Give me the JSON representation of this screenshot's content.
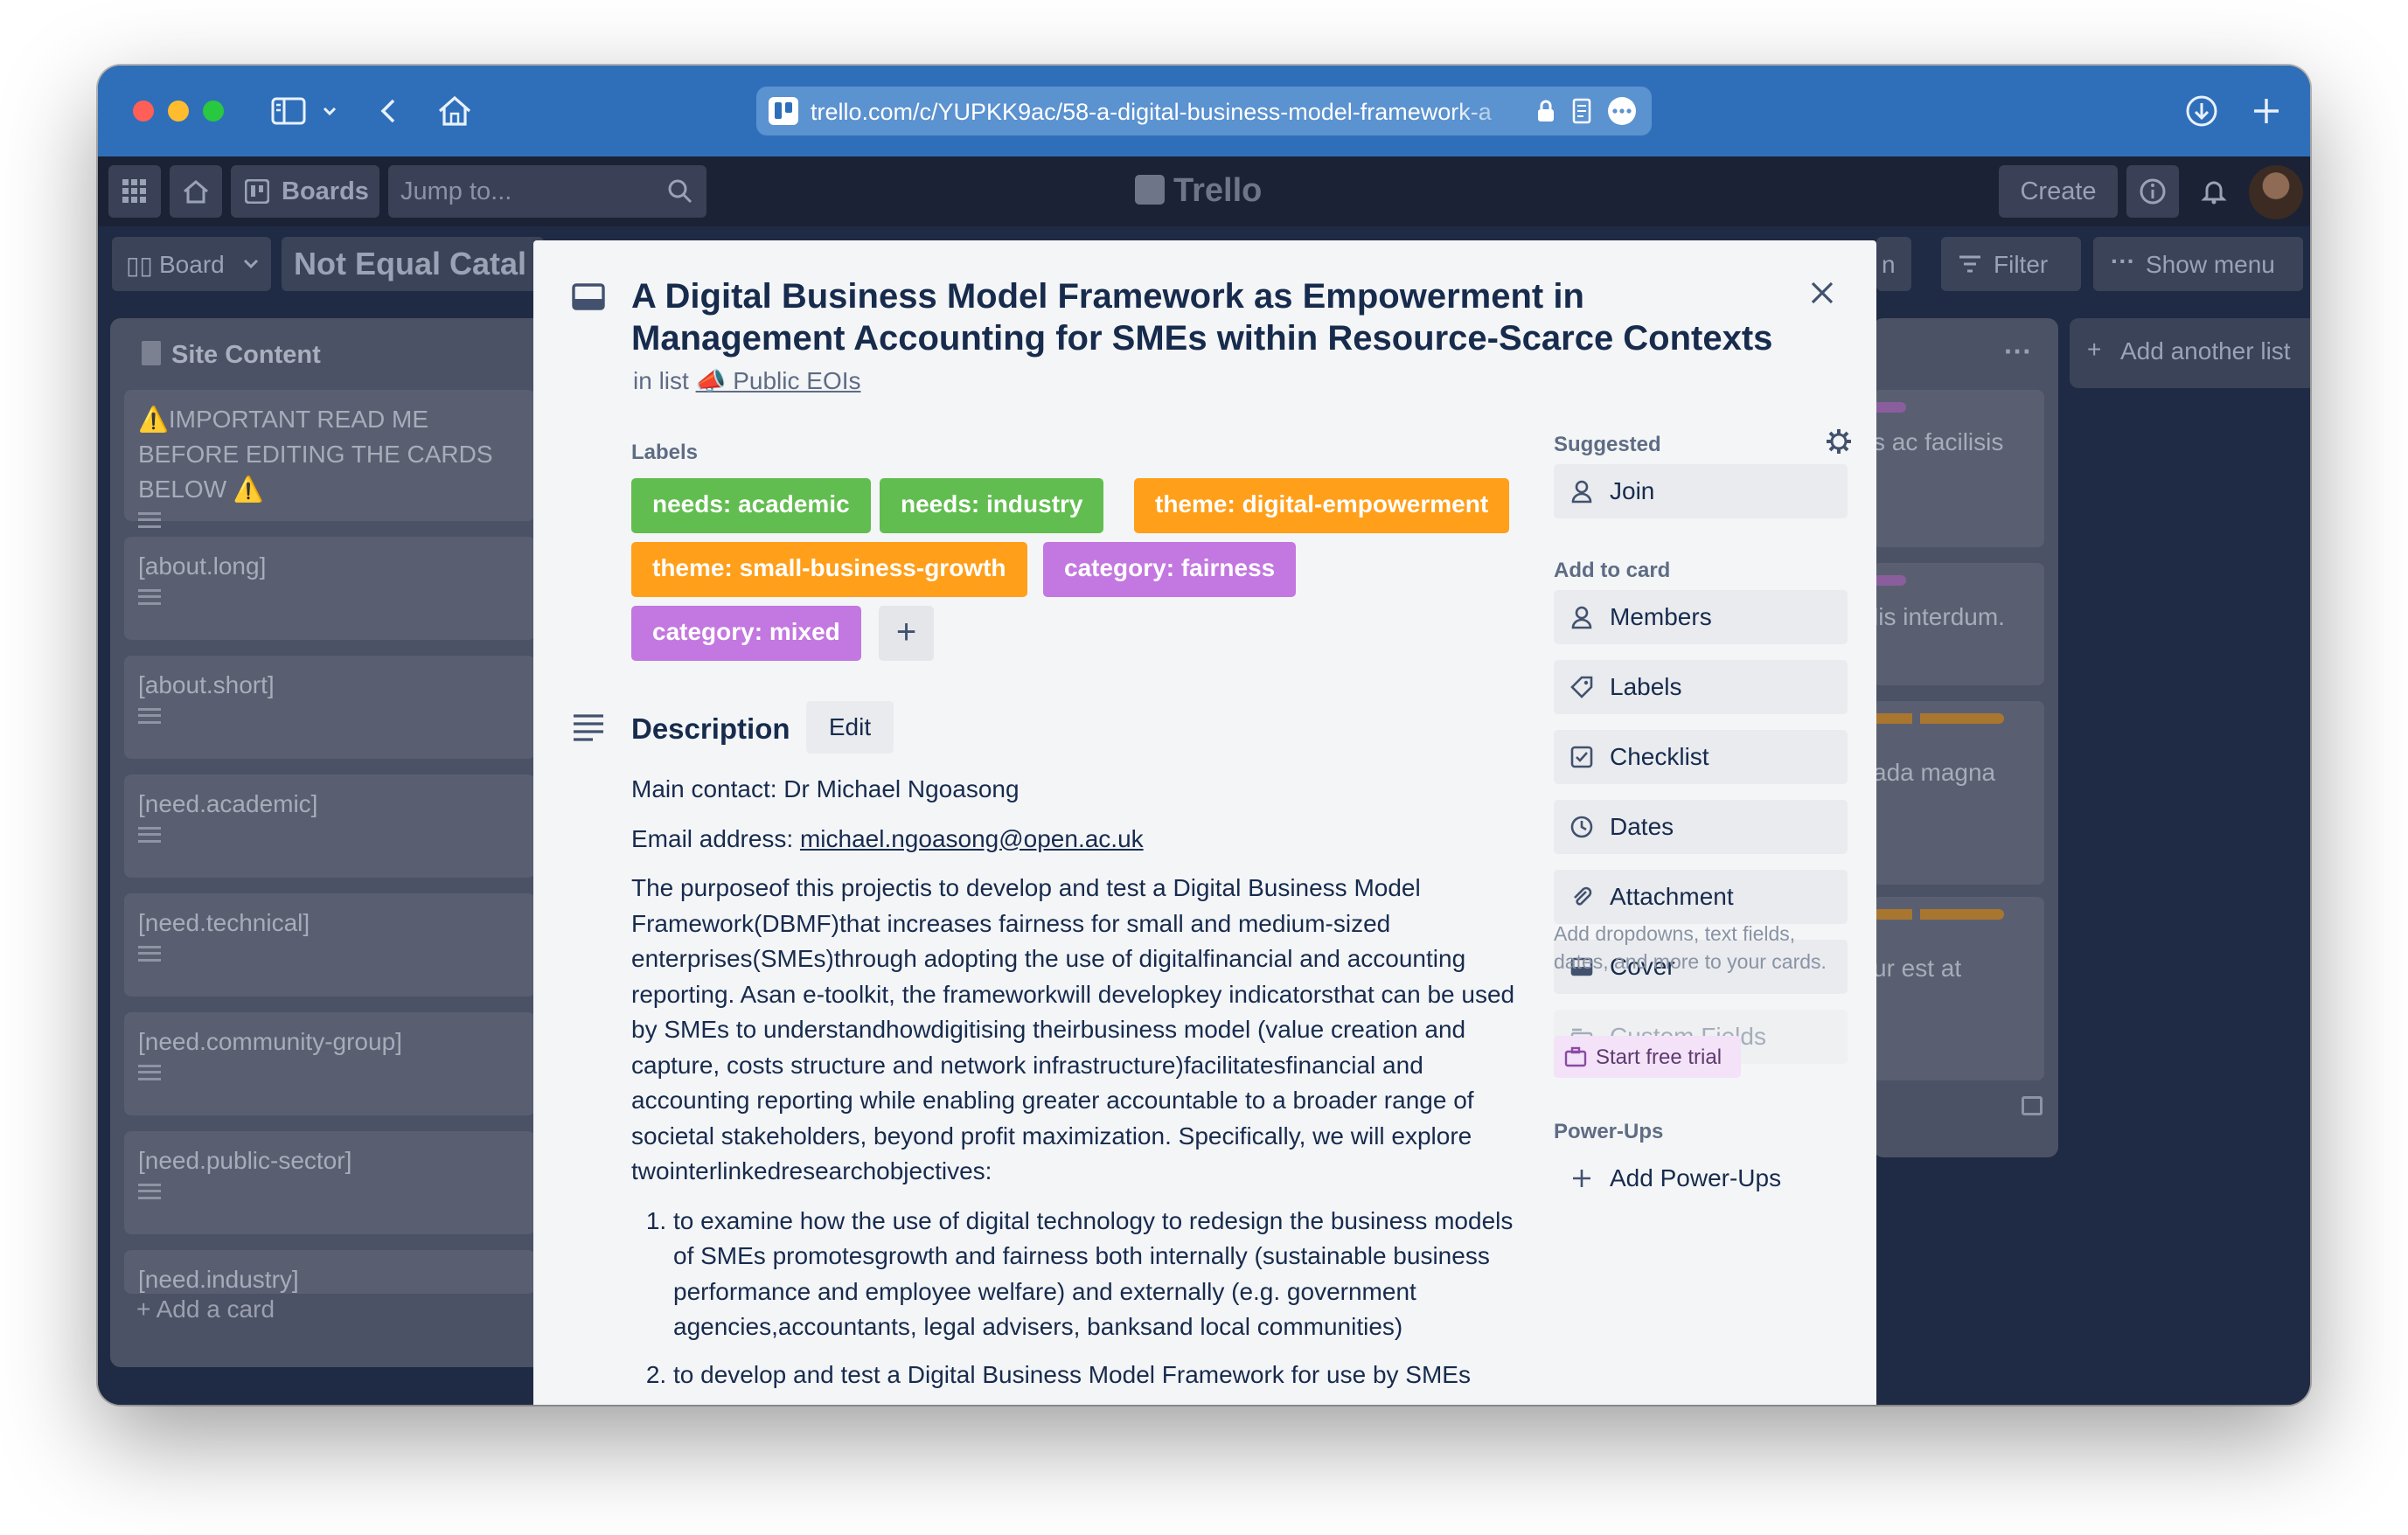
{
  "browser": {
    "url": "trello.com/c/YUPKK9ac/58-a-digital-business-model-framework-a",
    "traffic_colors": [
      "#ff5f57",
      "#febc2e",
      "#28c840"
    ]
  },
  "trello_nav": {
    "boards_label": "Boards",
    "search_placeholder": "Jump to...",
    "logo_text": "Trello",
    "create_label": "Create"
  },
  "board_bar": {
    "view_label": "Board",
    "board_name": "Not Equal Catal",
    "filter_label": "Filter",
    "show_menu_label": "Show menu",
    "add_list_label": "Add another list",
    "partial_text": "n"
  },
  "left_list": {
    "title": "Site Content",
    "cards": [
      "⚠️IMPORTANT READ ME BEFORE EDITING THE CARDS BELOW ⚠️",
      "[about.long]",
      "[about.short]",
      "[need.academic]",
      "[need.technical]",
      "[need.community-group]",
      "[need.public-sector]",
      "[need.industry]"
    ],
    "add_card_label": "Add a card"
  },
  "right_list": {
    "menu": "···",
    "cards": [
      "s ac facilisis",
      "lis interdum.",
      "ada magna",
      "ur est at"
    ]
  },
  "card": {
    "title": "A Digital Business Model Framework as Empowerment in Management Accounting for SMEs within Resource-Scarce Contexts",
    "in_list_prefix": "in list",
    "list_name": "📣 Public EOIs",
    "labels_heading": "Labels",
    "labels": [
      {
        "text": "needs: academic",
        "color": "#61bd4f"
      },
      {
        "text": "needs: industry",
        "color": "#61bd4f"
      },
      {
        "text": "theme: digital-empowerment",
        "color": "#ff9f1a"
      },
      {
        "text": "theme: small-business-growth",
        "color": "#ff9f1a"
      },
      {
        "text": "category: fairness",
        "color": "#c377e0"
      },
      {
        "text": "category: mixed",
        "color": "#c377e0"
      }
    ],
    "description_heading": "Description",
    "edit_label": "Edit",
    "contact_line": "Main contact: Dr Michael Ngoasong",
    "email_prefix": "Email address:",
    "email": "michael.ngoasong@open.ac.uk",
    "body": "The purposeof this projectis to develop and test a Digital Business Model Framework(DBMF)that increases fairness for small and medium-sized enterprises(SMEs)through adopting the use of digitalfinancial and accounting reporting. Asan e-toolkit, the frameworkwill developkey indicatorsthat can be used by SMEs to understandhowdigitising theirbusiness model (value creation and capture, costs structure and network infrastructure)facilitatesfinancial and accounting reporting while enabling greater accountable to a broader range of societal stakeholders, beyond profit maximization. Specifically, we will explore twointerlinkedresearchobjectives:",
    "objectives": [
      "to examine how the use of digital technology to redesign the business models of SMEs promotesgrowth and fairness both internally (sustainable business performance and employee welfare) and externally (e.g. government agencies,accountants, legal advisers, banksand local communities)",
      "to develop and test a Digital Business Model Framework for use by SMEs"
    ]
  },
  "sidebar": {
    "suggested_heading": "Suggested",
    "join_label": "Join",
    "add_to_card_heading": "Add to card",
    "buttons": [
      "Members",
      "Labels",
      "Checklist",
      "Dates",
      "Attachment",
      "Cover"
    ],
    "custom_fields_label": "Custom Fields",
    "custom_fields_note": "Add dropdowns, text fields, dates, and more to your cards.",
    "trial_label": "Start free trial",
    "powerups_heading": "Power-Ups",
    "add_powerups_label": "Add Power-Ups"
  }
}
